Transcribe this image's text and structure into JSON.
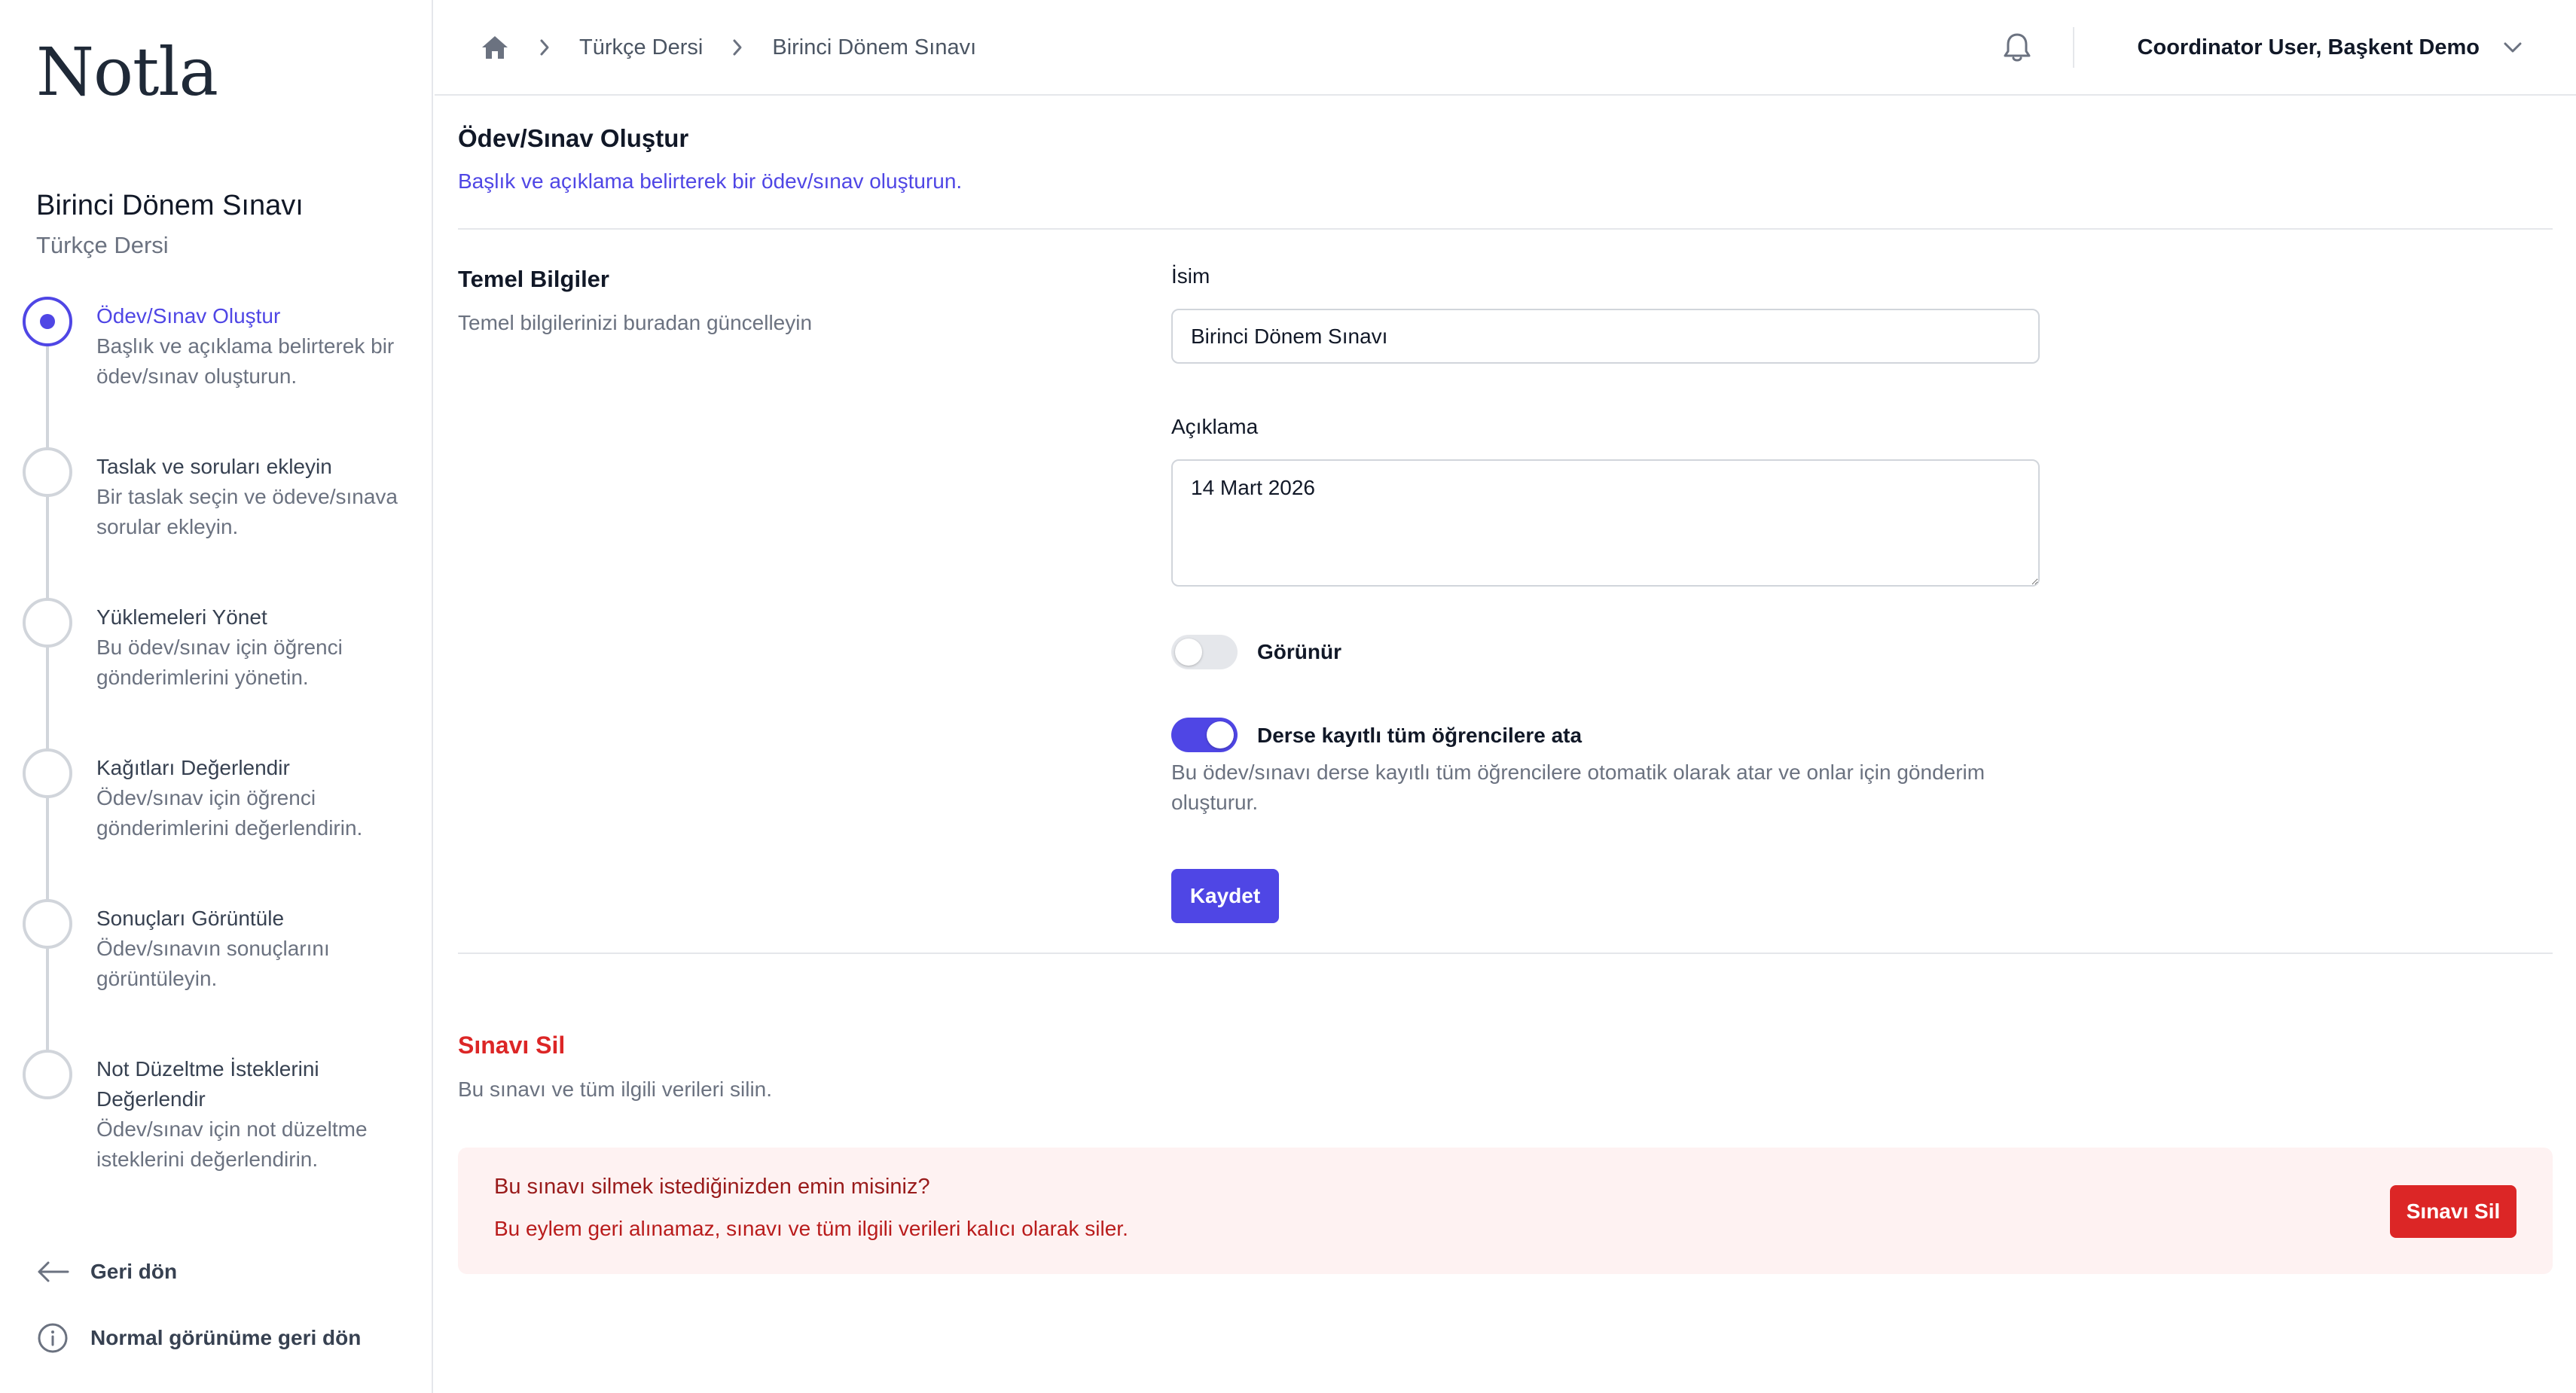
{
  "app": {
    "logo": "Notla"
  },
  "sidebar": {
    "exam_title": "Birinci Dönem Sınavı",
    "course": "Türkçe Dersi",
    "steps": [
      {
        "title": "Ödev/Sınav Oluştur",
        "desc": "Başlık ve açıklama belirterek bir ödev/sınav oluşturun.",
        "active": true
      },
      {
        "title": "Taslak ve soruları ekleyin",
        "desc": "Bir taslak seçin ve ödeve/sınava sorular ekleyin.",
        "active": false
      },
      {
        "title": "Yüklemeleri Yönet",
        "desc": "Bu ödev/sınav için öğrenci gönderimlerini yönetin.",
        "active": false
      },
      {
        "title": "Kağıtları Değerlendir",
        "desc": "Ödev/sınav için öğrenci gönderimlerini değerlendirin.",
        "active": false
      },
      {
        "title": "Sonuçları Görüntüle",
        "desc": "Ödev/sınavın sonuçlarını görüntüleyin.",
        "active": false
      },
      {
        "title": "Not Düzeltme İsteklerini Değerlendir",
        "desc": "Ödev/sınav için not düzeltme isteklerini değerlendirin.",
        "active": false
      }
    ],
    "back_label": "Geri dön",
    "normal_view_label": "Normal görünüme geri dön"
  },
  "header": {
    "breadcrumbs": [
      "Türkçe Dersi",
      "Birinci Dönem Sınavı"
    ],
    "user": "Coordinator User, Başkent Demo"
  },
  "main": {
    "title": "Ödev/Sınav Oluştur",
    "subtitle": "Başlık ve açıklama belirterek bir ödev/sınav oluşturun.",
    "section_title": "Temel Bilgiler",
    "section_desc": "Temel bilgilerinizi buradan güncelleyin",
    "name_label": "İsim",
    "name_value": "Birinci Dönem Sınavı",
    "desc_label": "Açıklama",
    "desc_value": "14 Mart 2026",
    "visible_label": "Görünür",
    "visible_on": false,
    "assign_label": "Derse kayıtlı tüm öğrencilere ata",
    "assign_on": true,
    "assign_help": "Bu ödev/sınavı derse kayıtlı tüm öğrencilere otomatik olarak atar ve onlar için gönderim oluşturur.",
    "save_label": "Kaydet"
  },
  "danger": {
    "title": "Sınavı Sil",
    "desc": "Bu sınavı ve tüm ilgili verileri silin.",
    "question": "Bu sınavı silmek istediğinizden emin misiniz?",
    "warning": "Bu eylem geri alınamaz, sınavı ve tüm ilgili verileri kalıcı olarak siler.",
    "button_label": "Sınavı Sil"
  },
  "colors": {
    "accent": "#4f46e5",
    "danger": "#dc2626",
    "danger_bg": "#fef2f2"
  }
}
